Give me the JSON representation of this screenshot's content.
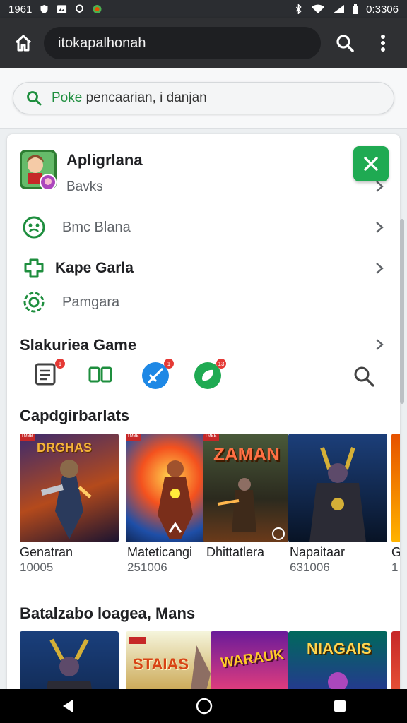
{
  "status_bar": {
    "time": "1961",
    "right_time": "0:3306"
  },
  "app_bar": {
    "url": "itokapalhonah"
  },
  "search": {
    "prefix": "Poke",
    "rest": " pencaarian, i danjan"
  },
  "app_card": {
    "title": "Apligrlana",
    "subtitle": "Bavks"
  },
  "menu": [
    {
      "label": "Bmc Blana"
    },
    {
      "label": "Kape Garla"
    },
    {
      "label": "Pamgara"
    }
  ],
  "category_section": {
    "title": "Slakuriea Game",
    "badges": [
      "1",
      "1",
      "1",
      "13"
    ]
  },
  "games_section": {
    "title": "Capdgirbarlats",
    "games": [
      {
        "banner": "DRGHAS",
        "ribbon": "TMBB",
        "name": "Genatran",
        "count": "10005"
      },
      {
        "banner": "",
        "ribbon": "TMBB",
        "name": "Mateticangi",
        "count": "251006"
      },
      {
        "banner": "ZAMAN",
        "ribbon": "TMBB",
        "name": "Dhittatlera",
        "count": ""
      },
      {
        "banner": "",
        "ribbon": "",
        "name": "Napaitaar",
        "count": "631006"
      },
      {
        "banner": "",
        "ribbon": "",
        "name": "G",
        "count": "1"
      }
    ]
  },
  "second_section": {
    "title": "Batalzabo loagea, Mans",
    "games": [
      {
        "banner": ""
      },
      {
        "banner": "STAIAS"
      },
      {
        "banner": "WARAUK"
      },
      {
        "banner": "NIAGAIS"
      }
    ]
  },
  "colors": {
    "accent": "#1faa52",
    "appbar": "#2f3033",
    "status": "#2b2d31"
  }
}
